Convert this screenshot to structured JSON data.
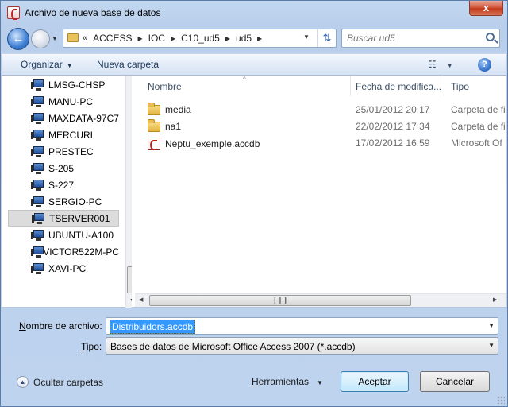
{
  "window": {
    "title": "Archivo de nueva base de datos",
    "close_glyph": "x"
  },
  "address": {
    "chevron": "«",
    "crumbs": [
      "ACCESS",
      "IOC",
      "C10_ud5",
      "ud5"
    ],
    "search_placeholder": "Buscar ud5"
  },
  "toolbar": {
    "organize": "Organizar",
    "new_folder": "Nueva carpeta",
    "help": "?"
  },
  "nav_items": [
    "LMSG-CHSP",
    "MANU-PC",
    "MAXDATA-97C7",
    "MERCURI",
    "PRESTEC",
    "S-205",
    "S-227",
    "SERGIO-PC",
    "TSERVER001",
    "UBUNTU-A100",
    "VICTOR522M-PC",
    "XAVI-PC"
  ],
  "nav_selected": "TSERVER001",
  "columns": {
    "name": "Nombre",
    "date": "Fecha de modifica...",
    "type": "Tipo"
  },
  "files": [
    {
      "name": "media",
      "date": "25/01/2012 20:17",
      "type": "Carpeta de fi",
      "icon": "folder-icon"
    },
    {
      "name": "na1",
      "date": "22/02/2012 17:34",
      "type": "Carpeta de fi",
      "icon": "folder-icon"
    },
    {
      "name": "Neptu_exemple.accdb",
      "date": "17/02/2012 16:59",
      "type": "Microsoft Of",
      "icon": "access-db-icon"
    }
  ],
  "form": {
    "filename_label_u": "N",
    "filename_label_rest": "ombre de archivo:",
    "filename_value": "Distribuidors.accdb",
    "type_label_u": "T",
    "type_label_rest": "ipo:",
    "type_value": "Bases de datos de Microsoft Office Access 2007 (*.accdb)"
  },
  "footer": {
    "hide_folders": "Ocultar carpetas",
    "tools_u": "H",
    "tools_rest": "erramientas",
    "accept": "Aceptar",
    "cancel": "Cancelar"
  },
  "colors": {
    "accent": "#3399ff",
    "frame": "#c3d7f0",
    "close": "#c23a1a"
  }
}
